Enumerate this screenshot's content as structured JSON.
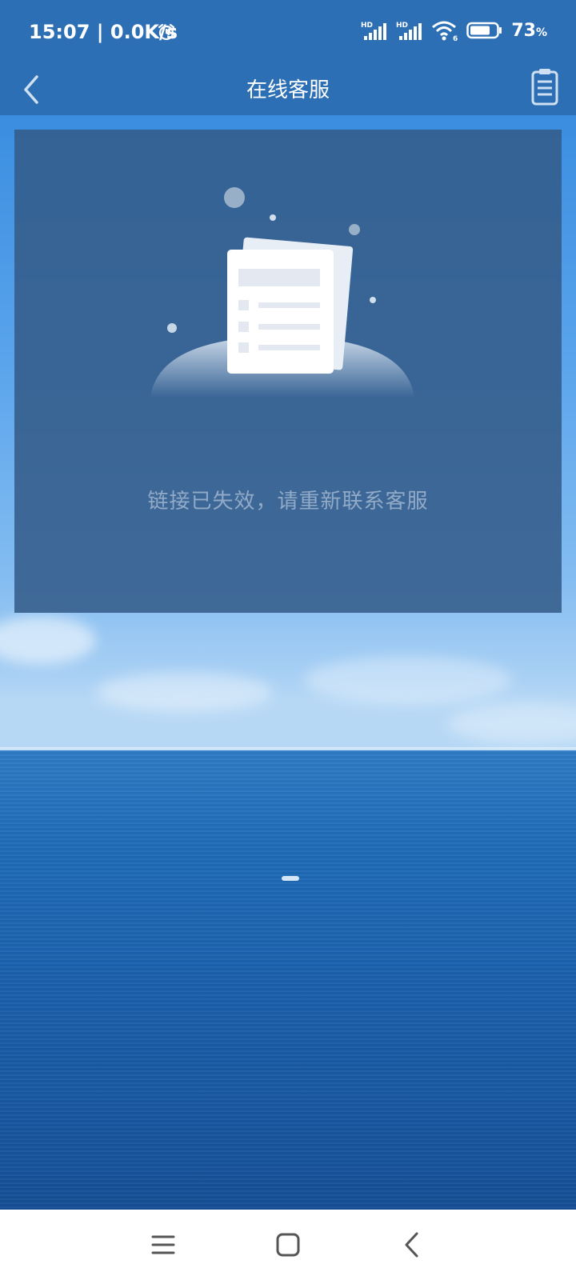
{
  "status_bar": {
    "time": "15:07",
    "network_speed": "0.0K/s",
    "battery_percent": "73",
    "battery_symbol": "%",
    "icons": [
      "alarm-icon",
      "signal-hd-icon",
      "signal-hd-icon",
      "wifi-6-icon",
      "battery-icon"
    ]
  },
  "header": {
    "title": "在线客服",
    "back_icon": "chevron-left-icon",
    "right_icon": "document-list-icon"
  },
  "empty_state": {
    "message": "链接已失效，请重新联系客服",
    "illustration": "document-illustration"
  },
  "nav_bar": {
    "buttons": [
      "menu-icon",
      "home-icon",
      "back-icon"
    ]
  },
  "colors": {
    "header_bg": "#2d6fb5",
    "card_bg": "#345c8a",
    "nav_bg": "#ffffff",
    "nav_icon": "#555555"
  }
}
